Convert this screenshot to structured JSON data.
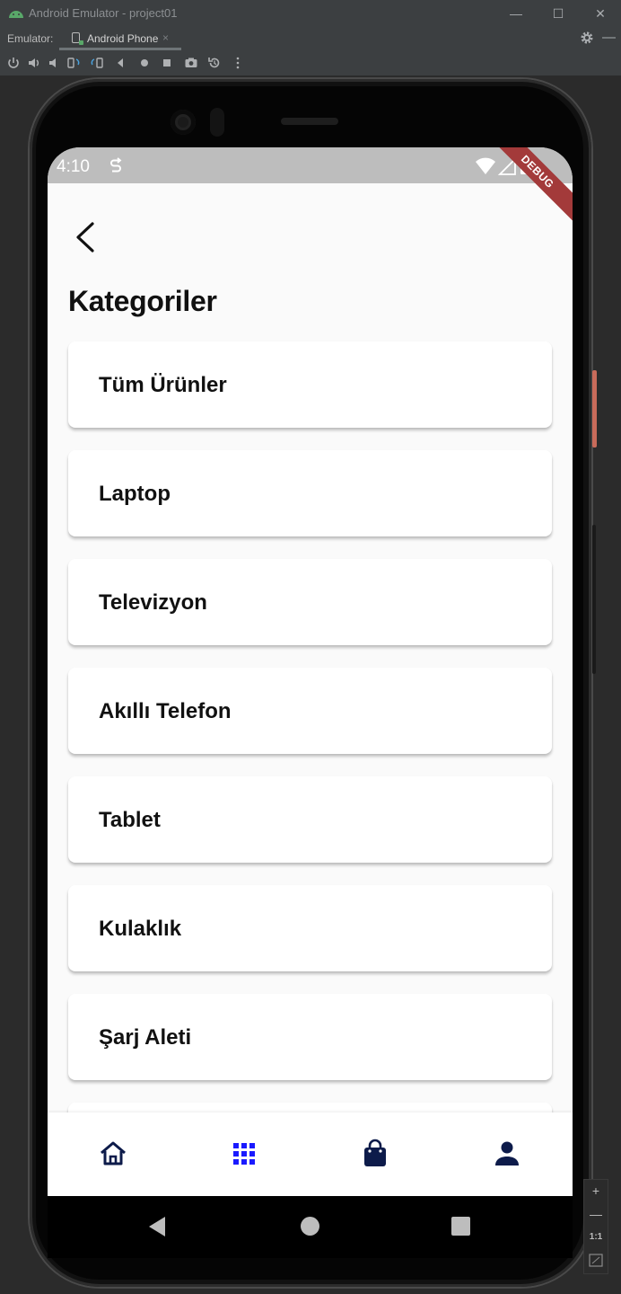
{
  "window": {
    "title": "Android Emulator - project01",
    "emulator_label": "Emulator:",
    "tab_name": "Android Phone",
    "tab_close": "×",
    "minimize": "—",
    "maximize": "☐",
    "close": "✕",
    "settings_icon": "gear-icon",
    "hide_icon": "—"
  },
  "toolbar": {
    "icons": [
      "power-icon",
      "volume-up-icon",
      "volume-down-icon",
      "rotate-left-icon",
      "rotate-right-icon",
      "back-icon",
      "home-icon",
      "overview-icon",
      "screenshot-icon",
      "snapshot-icon",
      "more-icon"
    ]
  },
  "status_bar": {
    "time": "4:10",
    "debug_banner": "DEBUG"
  },
  "page": {
    "title": "Kategoriler"
  },
  "categories": [
    {
      "label": "Tüm Ürünler"
    },
    {
      "label": "Laptop"
    },
    {
      "label": "Televizyon"
    },
    {
      "label": "Akıllı Telefon"
    },
    {
      "label": "Tablet"
    },
    {
      "label": "Kulaklık"
    },
    {
      "label": "Şarj Aleti"
    }
  ],
  "bottom_nav": {
    "items": [
      {
        "name": "home",
        "icon": "home-icon",
        "active": false
      },
      {
        "name": "categories",
        "icon": "grid-icon",
        "active": true
      },
      {
        "name": "cart",
        "icon": "shopping-bag-icon",
        "active": false
      },
      {
        "name": "profile",
        "icon": "person-icon",
        "active": false
      }
    ],
    "active_color": "#1a1aff",
    "inactive_color": "#0d1b4a"
  },
  "zoom": {
    "plus": "+",
    "minus": "—",
    "one_to_one": "1:1"
  },
  "colors": {
    "status_bar": "#bdbdbd",
    "screen_bg": "#fafafa",
    "card_bg": "#ffffff",
    "debug_ribbon": "#a33a3a",
    "power_button": "#c86b5a"
  }
}
